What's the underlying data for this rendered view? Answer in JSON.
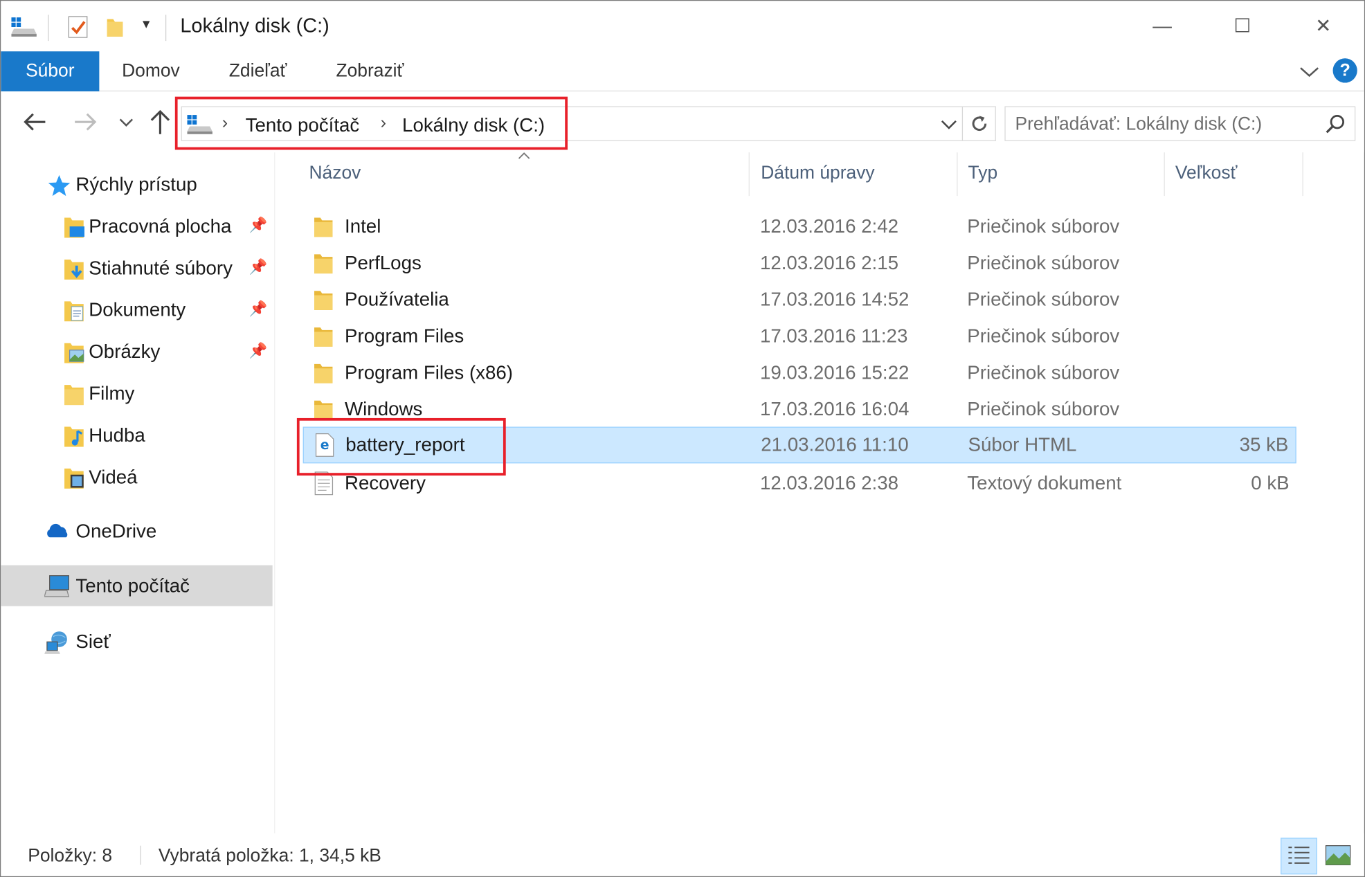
{
  "window": {
    "title": "Lokálny disk (C:)",
    "controls": {
      "minimize": "—",
      "maximize": "☐",
      "close": "✕"
    }
  },
  "ribbon": {
    "file_tab": "Súbor",
    "tabs": [
      "Domov",
      "Zdieľať",
      "Zobraziť"
    ],
    "help": "?"
  },
  "address": {
    "crumbs": [
      "Tento počítač",
      "Lokálny disk (C:)"
    ]
  },
  "search": {
    "placeholder": "Prehľadávať: Lokálny disk (C:)"
  },
  "sidebar": {
    "quick_access": "Rýchly prístup",
    "items": [
      {
        "label": "Pracovná plocha",
        "pinned": true
      },
      {
        "label": "Stiahnuté súbory",
        "pinned": true
      },
      {
        "label": "Dokumenty",
        "pinned": true
      },
      {
        "label": "Obrázky",
        "pinned": true
      },
      {
        "label": "Filmy",
        "pinned": false
      },
      {
        "label": "Hudba",
        "pinned": false
      },
      {
        "label": "Videá",
        "pinned": false
      }
    ],
    "onedrive": "OneDrive",
    "this_pc": "Tento počítač",
    "network": "Sieť"
  },
  "columns": {
    "name": "Názov",
    "date": "Dátum úpravy",
    "type": "Typ",
    "size": "Veľkosť"
  },
  "files": [
    {
      "name": "Intel",
      "date": "12.03.2016 2:42",
      "type": "Priečinok súborov",
      "size": "",
      "icon": "folder-icon"
    },
    {
      "name": "PerfLogs",
      "date": "12.03.2016 2:15",
      "type": "Priečinok súborov",
      "size": "",
      "icon": "folder-icon"
    },
    {
      "name": "Používatelia",
      "date": "17.03.2016 14:52",
      "type": "Priečinok súborov",
      "size": "",
      "icon": "folder-icon"
    },
    {
      "name": "Program Files",
      "date": "17.03.2016 11:23",
      "type": "Priečinok súborov",
      "size": "",
      "icon": "folder-icon"
    },
    {
      "name": "Program Files (x86)",
      "date": "19.03.2016 15:22",
      "type": "Priečinok súborov",
      "size": "",
      "icon": "folder-icon"
    },
    {
      "name": "Windows",
      "date": "17.03.2016 16:04",
      "type": "Priečinok súborov",
      "size": "",
      "icon": "folder-icon"
    },
    {
      "name": "battery_report",
      "date": "21.03.2016 11:10",
      "type": "Súbor HTML",
      "size": "35 kB",
      "icon": "edge-html-icon",
      "selected": true
    },
    {
      "name": "Recovery",
      "date": "12.03.2016 2:38",
      "type": "Textový dokument",
      "size": "0 kB",
      "icon": "text-document-icon"
    }
  ],
  "status": {
    "items": "Položky: 8",
    "selected": "Vybratá položka: 1, 34,5 kB"
  },
  "colors": {
    "accent": "#1979ca",
    "selection": "#cce8ff",
    "highlight_box": "#e8202a",
    "folder": "#f4c84b"
  }
}
